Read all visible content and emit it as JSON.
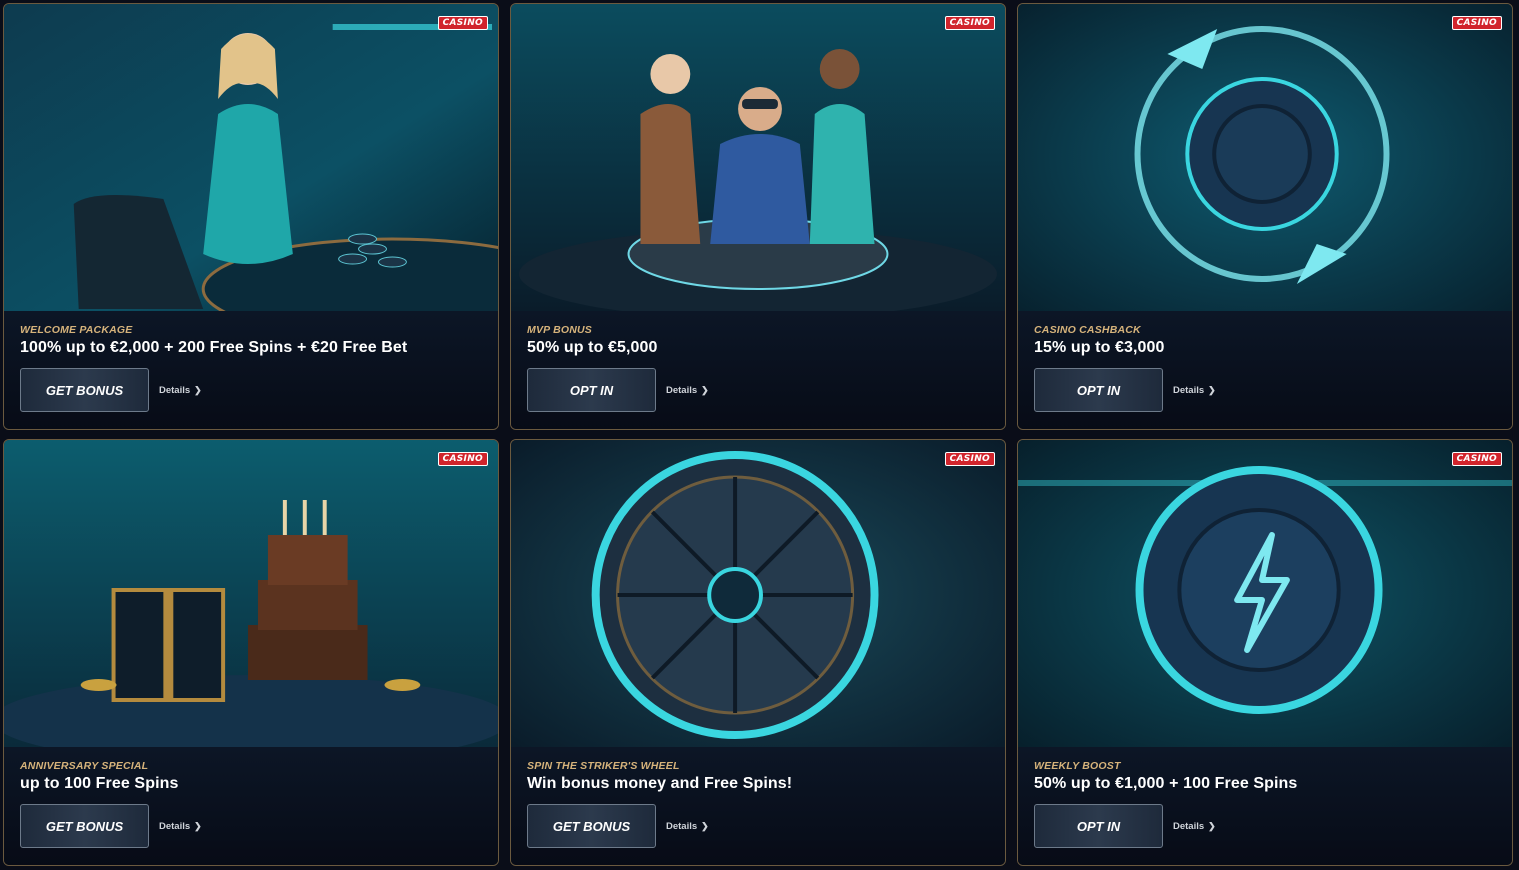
{
  "cards": [
    {
      "tag": "CASINO",
      "eyebrow": "WELCOME PACKAGE",
      "headline": "100% up to €2,000 + 200 Free Spins + €20 Free Bet",
      "cta": "GET BONUS",
      "details": "Details",
      "art": "woman-chips",
      "chevron": "chevron-right-icon"
    },
    {
      "tag": "CASINO",
      "eyebrow": "MVP BONUS",
      "headline": "50% up to €5,000",
      "cta": "OPT IN",
      "details": "Details",
      "art": "vip-group",
      "chevron": "chevron-right-icon"
    },
    {
      "tag": "CASINO",
      "eyebrow": "CASINO CASHBACK",
      "headline": "15% up to €3,000",
      "cta": "OPT IN",
      "details": "Details",
      "art": "cashback-chip",
      "chevron": "chevron-right-icon"
    },
    {
      "tag": "CASINO",
      "eyebrow": "ANNIVERSARY SPECIAL",
      "headline": "up to 100 Free Spins",
      "cta": "GET BONUS",
      "details": "Details",
      "art": "cake-gift",
      "chevron": "chevron-right-icon"
    },
    {
      "tag": "CASINO",
      "eyebrow": "SPIN THE STRIKER'S WHEEL",
      "headline": "Win bonus money and Free Spins!",
      "cta": "GET BONUS",
      "details": "Details",
      "art": "prize-wheel",
      "chevron": "chevron-right-icon"
    },
    {
      "tag": "CASINO",
      "eyebrow": "WEEKLY BOOST",
      "headline": "50% up to €1,000 + 100 Free Spins",
      "cta": "OPT IN",
      "details": "Details",
      "art": "lightning-chip",
      "chevron": "chevron-right-icon"
    }
  ],
  "colors": {
    "accent_gold": "#d6b37b",
    "tag_red": "#d1242c",
    "teal": "#3ad6e0"
  }
}
